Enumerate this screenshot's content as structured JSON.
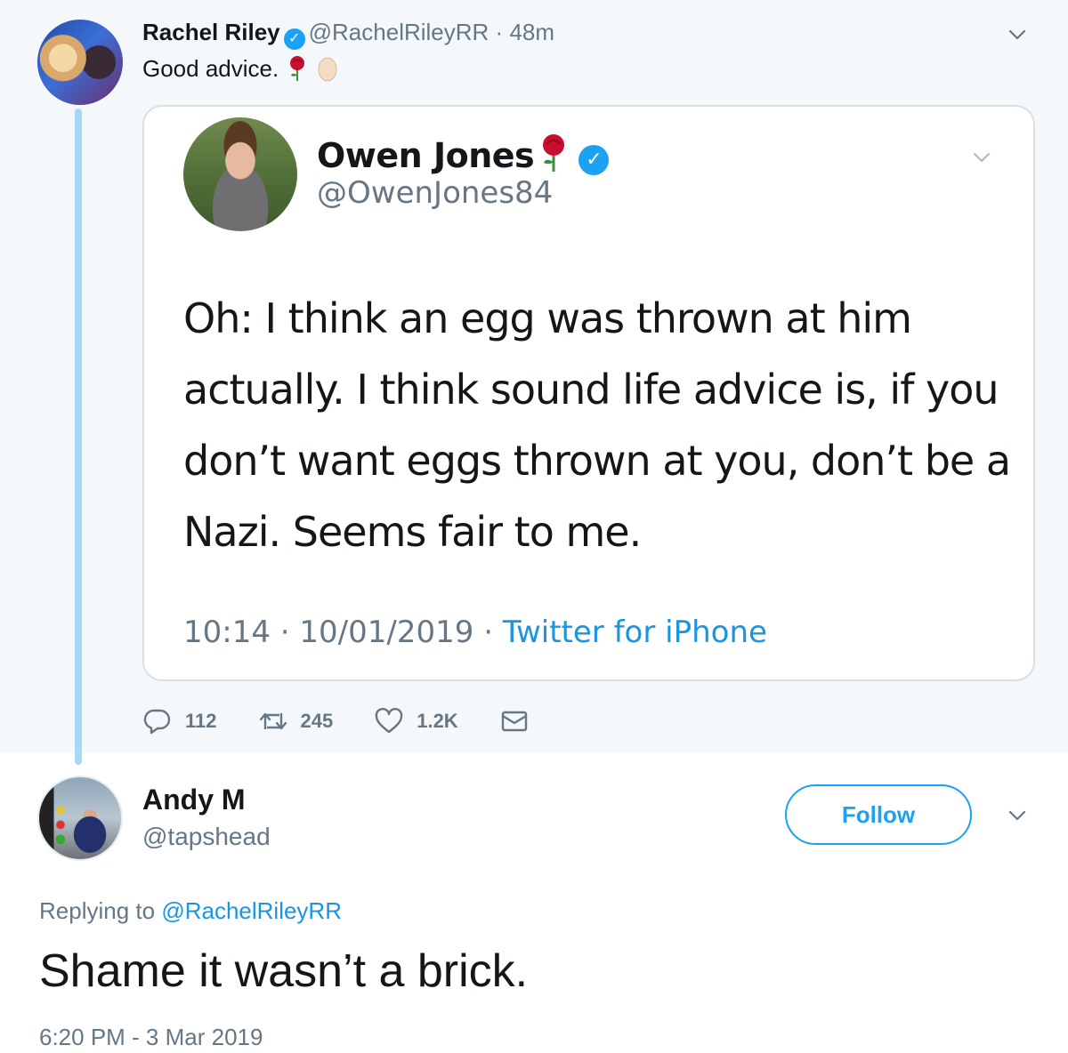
{
  "main_tweet": {
    "author_name": "Rachel Riley",
    "handle": "@RachelRileyRR",
    "separator": "·",
    "time_ago": "48m",
    "text": "Good advice.",
    "emojis": [
      "rose-icon",
      "egg-icon"
    ]
  },
  "quoted_tweet": {
    "author_name": "Owen Jones",
    "handle": "@OwenJones84",
    "text": "Oh: I think an egg was thrown at him actually. I think sound life advice is, if you don’t want eggs thrown at you, don’t be a Nazi. Seems fair to me.",
    "time": "10:14",
    "date": "10/01/2019",
    "separator": "·",
    "source": "Twitter for iPhone"
  },
  "actions": {
    "replies": "112",
    "retweets": "245",
    "likes": "1.2K"
  },
  "reply_tweet": {
    "author_name": "Andy M",
    "handle": "@tapshead",
    "follow_label": "Follow",
    "replying_prefix": "Replying to",
    "replying_to": "@RachelRileyRR",
    "text": "Shame it wasn’t a brick.",
    "timestamp": "6:20 PM - 3 Mar 2019"
  },
  "colors": {
    "accent": "#1da1f2",
    "link": "#1b95e0",
    "muted": "#657786",
    "thread_line": "#a7d8f5",
    "top_background": "#f5f8fa"
  }
}
